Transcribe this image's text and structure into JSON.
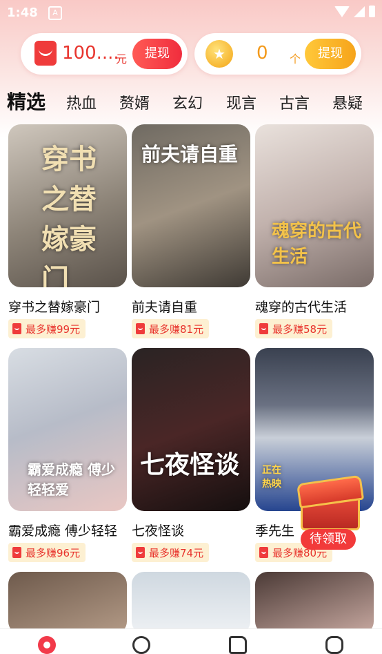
{
  "status_bar": {
    "time": "1:48",
    "notif": "A"
  },
  "wallet": {
    "cash_amount": "100....",
    "cash_unit": "元",
    "cash_button": "提现",
    "coin_count": "0",
    "coin_unit": "个",
    "coin_button": "提现",
    "coin_glyph": "★"
  },
  "tabs": [
    "精选",
    "热血",
    "赘婿",
    "玄幻",
    "现言",
    "古言",
    "悬疑"
  ],
  "books": [
    {
      "title": "穿书之替嫁豪门",
      "earn": "最多赚99元",
      "cover_text": "穿书之替嫁豪门"
    },
    {
      "title": "前夫请自重",
      "earn": "最多赚81元",
      "cover_text": "前夫请自重"
    },
    {
      "title": "魂穿的古代生活",
      "earn": "最多赚58元",
      "cover_text": "魂穿的古代生活"
    },
    {
      "title": "霸爱成瘾 傅少轻轻",
      "earn": "最多赚96元",
      "cover_text": "霸爱成瘾 傅少轻轻爱"
    },
    {
      "title": "七夜怪谈",
      "earn": "最多赚74元",
      "cover_text": "七夜怪谈"
    },
    {
      "title": "季先生",
      "earn": "最多赚80元",
      "cover_text": "正在热映"
    }
  ],
  "chest": {
    "label": "待领取"
  },
  "colors": {
    "accent": "#f23a3a",
    "coin": "#f39a1c",
    "earn_bg": "#fdf0d2"
  }
}
